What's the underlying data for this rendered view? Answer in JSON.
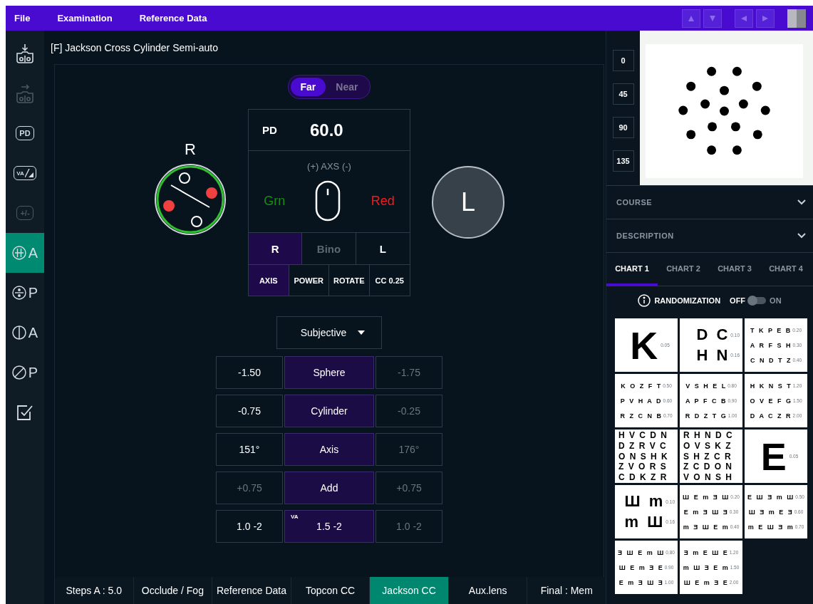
{
  "menu_bar": {
    "items": [
      "File",
      "Examination",
      "Reference Data"
    ]
  },
  "sidebar": {
    "items": [
      {
        "kind": "tray_in",
        "disabled": false,
        "selected": false
      },
      {
        "kind": "tray_out",
        "disabled": true,
        "selected": false
      },
      {
        "kind": "boxed",
        "label": "PD",
        "disabled": false,
        "selected": false
      },
      {
        "kind": "va",
        "label": "VA",
        "disabled": false,
        "selected": false
      },
      {
        "kind": "boxed",
        "label": "+/-",
        "disabled": true,
        "selected": false
      },
      {
        "kind": "cross_grid",
        "label": "A",
        "disabled": false,
        "selected": true
      },
      {
        "kind": "cross_dots",
        "label": "P",
        "disabled": false,
        "selected": false
      },
      {
        "kind": "split_circle",
        "label": "A",
        "disabled": false,
        "selected": false
      },
      {
        "kind": "slash_circle",
        "label": "P",
        "disabled": false,
        "selected": false
      },
      {
        "kind": "checkbox",
        "disabled": false,
        "selected": false
      }
    ]
  },
  "title": "[F] Jackson Cross Cylinder Semi-auto",
  "distance_toggle": [
    {
      "label": "Far",
      "selected": true
    },
    {
      "label": "Near",
      "selected": false
    }
  ],
  "right_eye": {
    "label": "R"
  },
  "left_eye": {
    "label": "L"
  },
  "control_card": {
    "pd_label": "PD",
    "pd_value": "60.0",
    "axis_caption": "(+) AXS (-)",
    "green_label": "Grn",
    "red_label": "Red",
    "eyes": [
      {
        "label": "R",
        "selected": true,
        "disabled": false
      },
      {
        "label": "Bino",
        "selected": false,
        "disabled": true
      },
      {
        "label": "L",
        "selected": false,
        "disabled": false
      }
    ],
    "modes": [
      {
        "label": "AXIS",
        "selected": true
      },
      {
        "label": "POWER",
        "selected": false
      },
      {
        "label": "ROTATE",
        "selected": false
      },
      {
        "label": "CC 0.25",
        "selected": false
      }
    ]
  },
  "mode_dropdown": {
    "value": "Subjective"
  },
  "values_table": {
    "rows": [
      {
        "r": {
          "text": "-1.50",
          "dim": false
        },
        "center": {
          "text": "Sphere"
        },
        "l": {
          "text": "-1.75",
          "dim": true
        }
      },
      {
        "r": {
          "text": "-0.75",
          "dim": false
        },
        "center": {
          "text": "Cylinder"
        },
        "l": {
          "text": "-0.25",
          "dim": true
        }
      },
      {
        "r": {
          "text": "151°",
          "dim": false
        },
        "center": {
          "text": "Axis"
        },
        "l": {
          "text": "176°",
          "dim": true
        }
      },
      {
        "r": {
          "text": "+0.75",
          "dim": true
        },
        "center": {
          "text": "Add"
        },
        "l": {
          "text": "+0.75",
          "dim": true
        }
      },
      {
        "r": {
          "text": "1.0 -2",
          "dim": false
        },
        "center": {
          "text": "1.5 -2",
          "tag": "VA"
        },
        "l": {
          "text": "1.0 -2",
          "dim": true
        }
      }
    ]
  },
  "bottom_tabs": [
    {
      "label": "Steps A : 5.0",
      "selected": false
    },
    {
      "label": "Occlude / Fog",
      "selected": false
    },
    {
      "label": "Reference Data",
      "selected": false
    },
    {
      "label": "Topcon CC",
      "selected": false
    },
    {
      "label": "Jackson CC",
      "selected": true
    },
    {
      "label": "Aux.lens",
      "selected": false
    },
    {
      "label": "Final : Mem",
      "selected": false
    }
  ],
  "axis_buttons": [
    "0",
    "45",
    "90",
    "135"
  ],
  "sections": [
    {
      "title": "COURSE",
      "expanded": false
    },
    {
      "title": "DESCRIPTION",
      "expanded": false
    }
  ],
  "chart_tabs": [
    {
      "label": "CHART 1",
      "selected": true
    },
    {
      "label": "CHART 2",
      "selected": false
    },
    {
      "label": "CHART 3",
      "selected": false
    },
    {
      "label": "CHART 4",
      "selected": false
    }
  ],
  "randomization": {
    "label": "RANDOMIZATION",
    "off_label": "OFF",
    "on_label": "ON",
    "on": false
  },
  "chart_cells": [
    {
      "kind": "single",
      "letters": "K",
      "value": "0.05"
    },
    {
      "kind": "pairs",
      "rows": [
        {
          "letters": "D C",
          "value": "0.10"
        },
        {
          "letters": "H N",
          "value": "0.16"
        }
      ]
    },
    {
      "kind": "lines",
      "rows": [
        {
          "letters": "T K P E B",
          "value": "0.20"
        },
        {
          "letters": "A R F S H",
          "value": "0.30"
        },
        {
          "letters": "C N D T Z",
          "value": "0.40"
        }
      ]
    },
    {
      "kind": "lines",
      "rows": [
        {
          "letters": "K O Z F T",
          "value": "0.50"
        },
        {
          "letters": "P V H A D",
          "value": "0.60"
        },
        {
          "letters": "R Z C N B",
          "value": "0.70"
        }
      ]
    },
    {
      "kind": "lines",
      "rows": [
        {
          "letters": "V S H E L",
          "value": "0.80"
        },
        {
          "letters": "A P F C B",
          "value": "0.90"
        },
        {
          "letters": "R D Z T G",
          "value": "1.00"
        }
      ]
    },
    {
      "kind": "lines",
      "rows": [
        {
          "letters": "H K N S T",
          "value": "1.20"
        },
        {
          "letters": "O V E F G",
          "value": "1.50"
        },
        {
          "letters": "D A C Z R",
          "value": "2.00"
        }
      ]
    },
    {
      "kind": "block",
      "rows": [
        "H V C D N",
        "D Z R V C",
        "O N S H K",
        "Z V O R S",
        "C D K Z R"
      ]
    },
    {
      "kind": "block",
      "rows": [
        "R H N D C",
        "O V S K Z",
        "S H Z C R",
        "Z C D O N",
        "V O N S H"
      ]
    },
    {
      "kind": "single",
      "letters": "E",
      "value": "0.05"
    },
    {
      "kind": "pairs",
      "rows": [
        {
          "letters": "Ш m",
          "value": "0.10"
        },
        {
          "letters": "m Ш",
          "value": "0.16"
        }
      ]
    },
    {
      "kind": "lines",
      "rows": [
        {
          "letters": "Ш E m Ǝ Ш",
          "value": "0.20"
        },
        {
          "letters": "E m Ǝ Ш Ǝ",
          "value": "0.30"
        },
        {
          "letters": "m Ǝ Ш E m",
          "value": "0.40"
        }
      ]
    },
    {
      "kind": "lines",
      "rows": [
        {
          "letters": "E Ш Ǝ m Ш",
          "value": "0.50"
        },
        {
          "letters": "Ш Ǝ m E Ǝ",
          "value": "0.60"
        },
        {
          "letters": "m E Ш Ǝ m",
          "value": "0.70"
        }
      ]
    },
    {
      "kind": "lines",
      "rows": [
        {
          "letters": "Ǝ Ш E m Ш",
          "value": "0.80"
        },
        {
          "letters": "Ш E m Ǝ E",
          "value": "0.90"
        },
        {
          "letters": "E m Ǝ Ш Ǝ",
          "value": "1.00"
        }
      ]
    },
    {
      "kind": "lines",
      "rows": [
        {
          "letters": "Ǝ m E Ш E",
          "value": "1.20"
        },
        {
          "letters": "m Ш Ǝ E m",
          "value": "1.50"
        },
        {
          "letters": "Ш E m Ǝ E",
          "value": "2.00"
        }
      ]
    }
  ]
}
